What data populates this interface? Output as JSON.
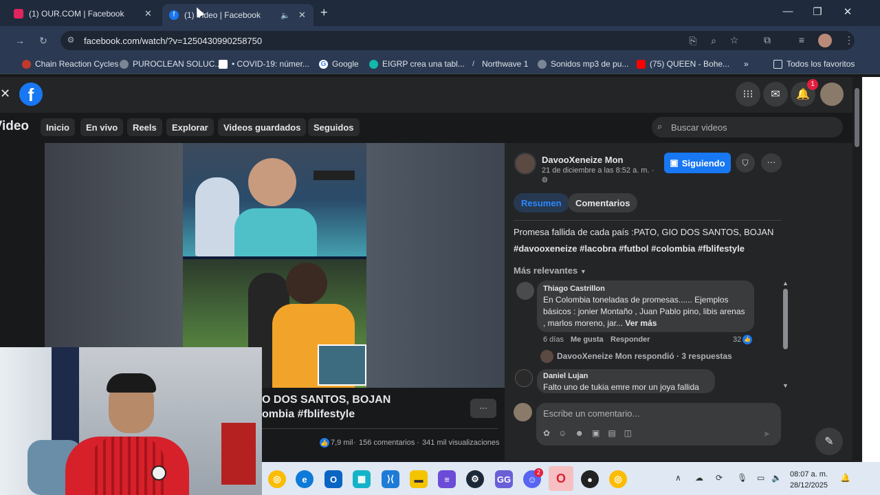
{
  "browser": {
    "tabs": [
      {
        "title": "(1) OUR.COM | Facebook",
        "active": false
      },
      {
        "title": "(1) Video | Facebook",
        "active": true
      }
    ],
    "url": "facebook.com/watch/?v=1250430990258750",
    "bookmarks": [
      "Chain Reaction Cycles",
      "PUROCLEAN SOLUC...",
      "• COVID-19: númer...",
      "Google",
      "EIGRP crea una tabl...",
      "Northwave 1",
      "Sonidos mp3 de pu...",
      "(75) QUEEN - Bohe..."
    ],
    "all_bookmarks": "Todos los favoritos"
  },
  "facebook": {
    "notification_count": "1",
    "section_title": "Video",
    "nav": [
      "Inicio",
      "En vivo",
      "Reels",
      "Explorar",
      "Videos guardados",
      "Seguidos"
    ],
    "search_placeholder": "Buscar videos"
  },
  "video": {
    "title_line1": "O DOS SANTOS, BOJAN",
    "title_line2": "ombia #fblifestyle",
    "likes": "7,9 mil",
    "comments": "156 comentarios",
    "views": "341 mil visualizaciones",
    "more": "···"
  },
  "post": {
    "author": "DavooXeneize Mon",
    "date": "21 de diciembre a las 8:52 a. m. ·",
    "follow_label": "Siguiendo",
    "tabs": [
      "Resumen",
      "Comentarios"
    ],
    "text": "Promesa fallida de cada país :PATO, GIO DOS SANTOS, BOJAN",
    "hashtags": "#davooxeneize #lacobra #futbol #colombia #fblifestyle",
    "sort": "Más relevantes"
  },
  "comments": [
    {
      "name": "Thiago Castrillon",
      "text": "En Colombia toneladas de promesas...... Ejemplos básicos : jonier Montaño , Juan Pablo pino, libis arenas , marlos moreno, jar...",
      "see_more": "Ver más",
      "time": "6 días",
      "like": "Me gusta",
      "reply": "Responder",
      "reactions": "32",
      "replies_text": "DavooXeneize Mon respondió · 3 respuestas"
    },
    {
      "name": "Daniel Lujan",
      "text": "Falto uno de tukia emre mor un joya fallida"
    }
  ],
  "composer": {
    "placeholder": "Escribe un comentario..."
  },
  "taskbar": {
    "time": "08:07 a. m.",
    "date": "28/12/2025",
    "discord_badge": "2"
  },
  "colors": {
    "accent": "#1877f2",
    "tabbar": "#1f2a3c",
    "fb_bg": "#18191a"
  }
}
